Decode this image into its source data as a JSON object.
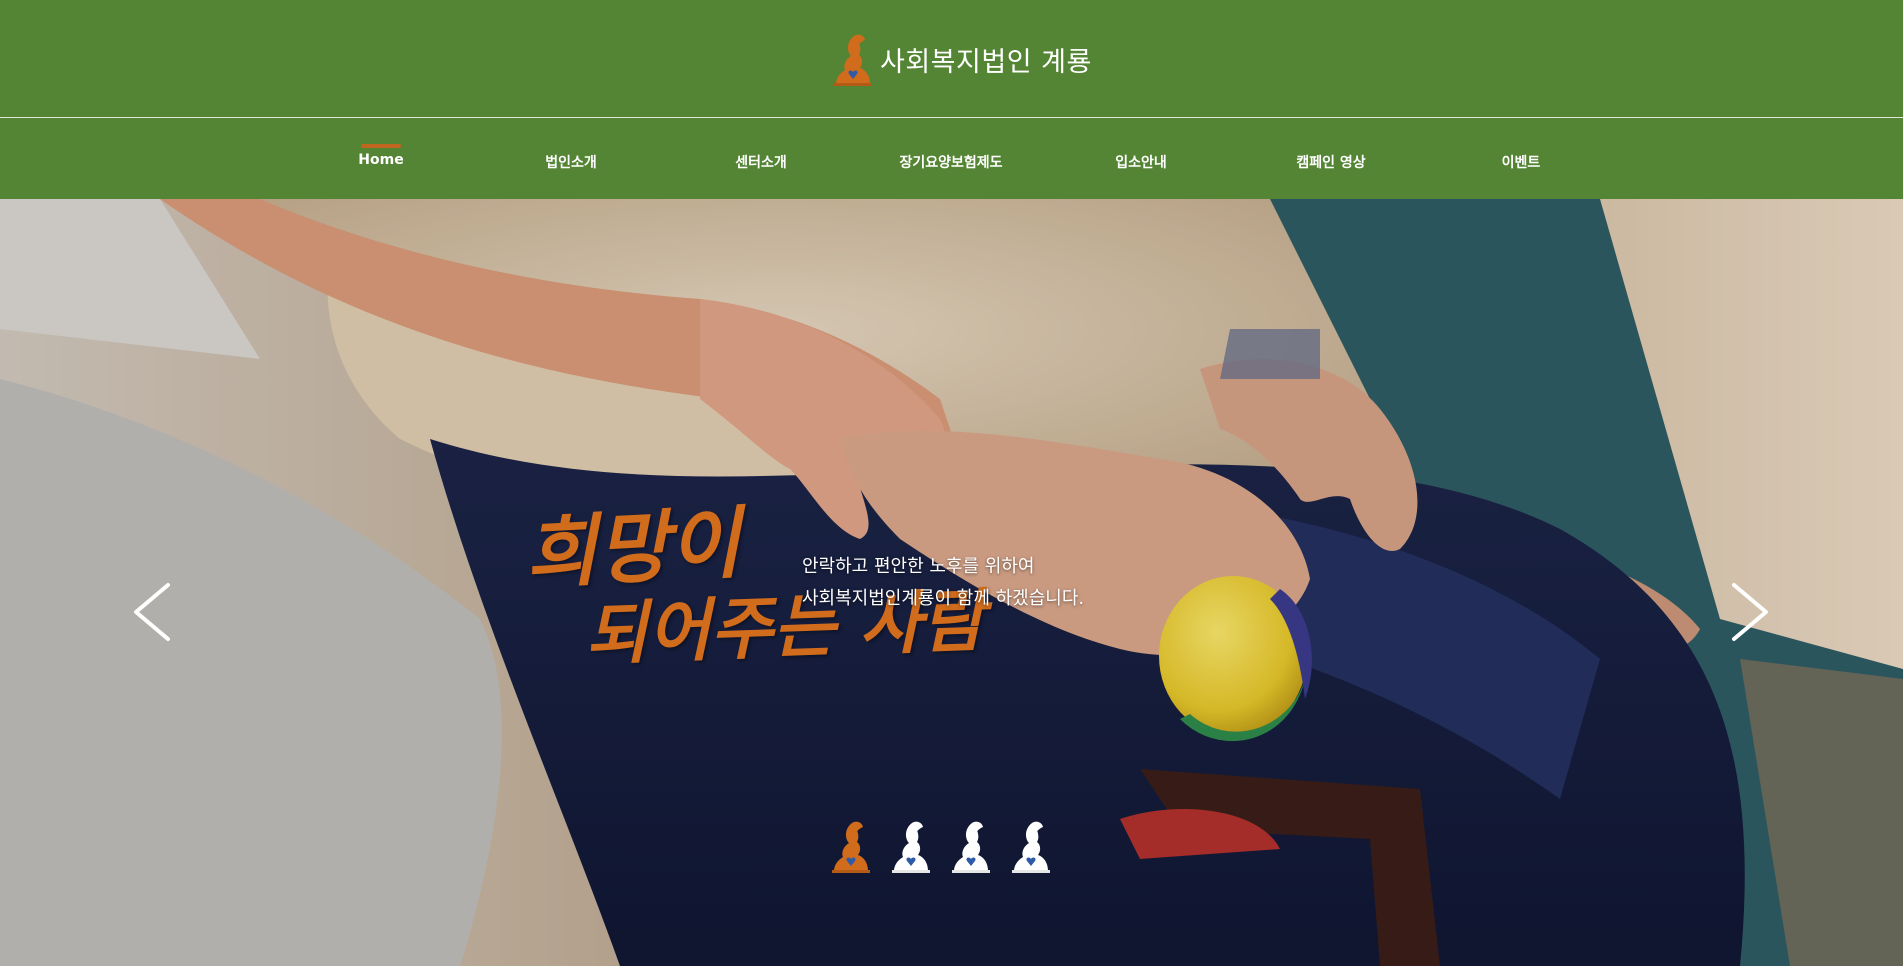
{
  "header": {
    "title": "사회복지법인 계룡",
    "logo_icon": "rabbit-heart-logo-icon"
  },
  "nav": {
    "items": [
      {
        "label": "Home",
        "active": true
      },
      {
        "label": "법인소개",
        "active": false
      },
      {
        "label": "센터소개",
        "active": false
      },
      {
        "label": "장기요양보험제도",
        "active": false
      },
      {
        "label": "입소안내",
        "active": false
      },
      {
        "label": "캠페인 영상",
        "active": false
      },
      {
        "label": "이벤트",
        "active": false
      }
    ]
  },
  "hero": {
    "headline_line1": "희망이",
    "headline_line2": "되어주는 사람",
    "tagline_line1": "안락하고 편안한 노후를 위하여",
    "tagline_line2": "사회복지법인계룡이 함께 하겠습니다.",
    "prev_icon": "chevron-left-icon",
    "next_icon": "chevron-right-icon",
    "slide_count": 4,
    "active_slide": 1
  },
  "colors": {
    "brand_green": "#548534",
    "accent_orange": "#d06c1c",
    "heart_blue": "#2f5aa8",
    "white": "#ffffff"
  }
}
